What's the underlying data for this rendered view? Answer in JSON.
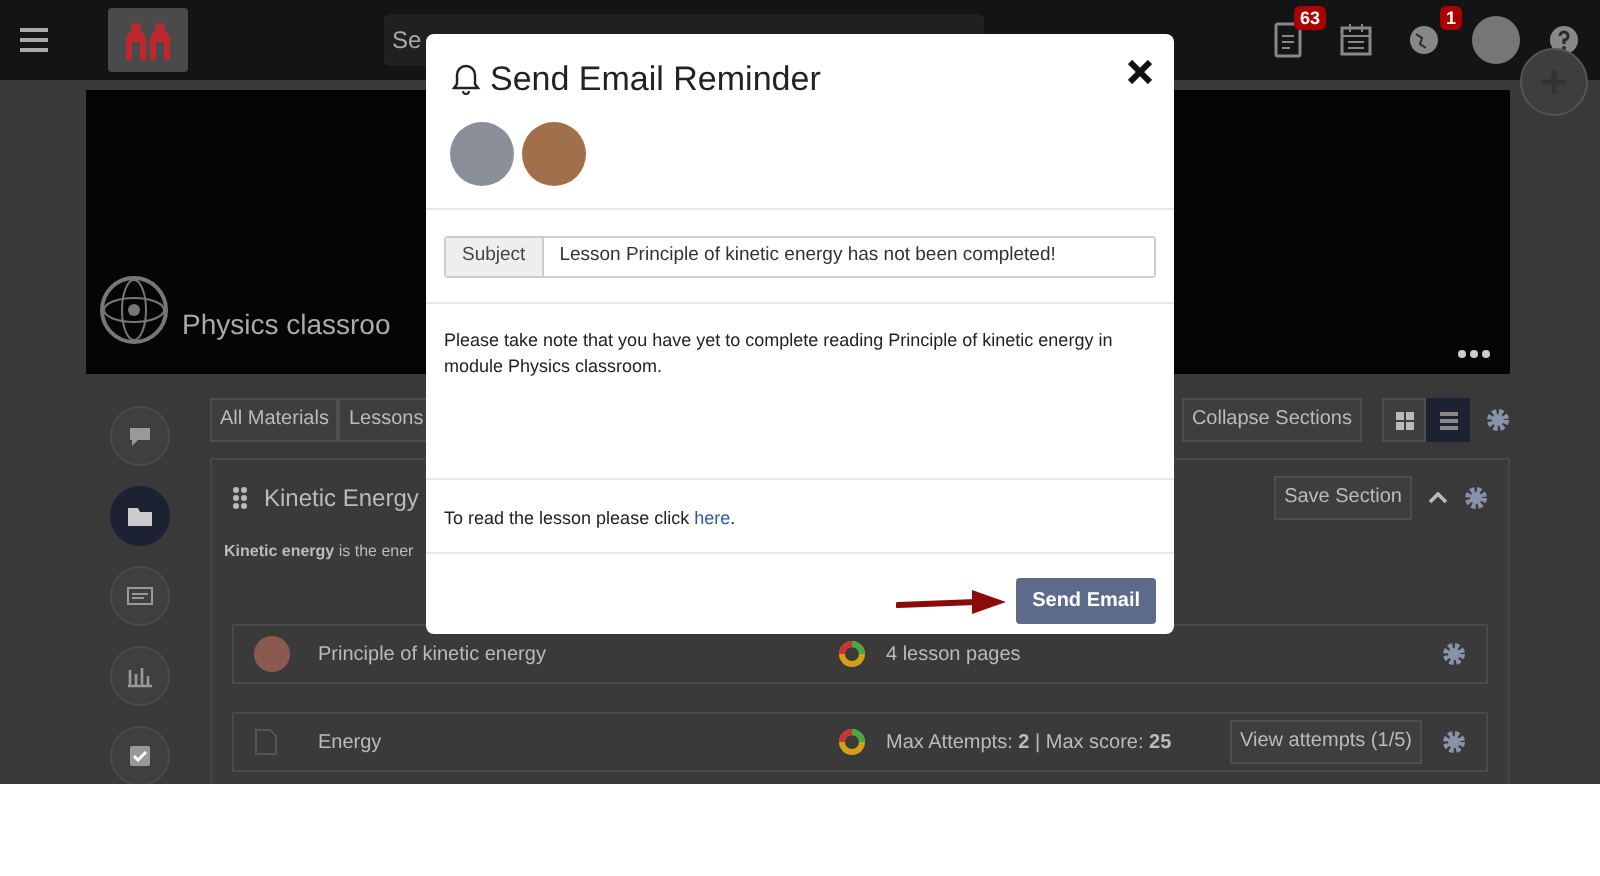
{
  "topbar": {
    "search_placeholder": "Se",
    "badges": [
      "63",
      "1"
    ]
  },
  "banner": {
    "title": "Physics classroo"
  },
  "sidebar": {
    "items": [
      {
        "kind": "chat",
        "selected": false
      },
      {
        "kind": "folder",
        "selected": true
      },
      {
        "kind": "card",
        "selected": false
      },
      {
        "kind": "chart",
        "selected": false
      },
      {
        "kind": "check",
        "selected": false
      }
    ]
  },
  "toolbar": {
    "filters": [
      "All Materials",
      "Lessons"
    ],
    "collapse_button": "Collapse Sections",
    "views": [
      {
        "kind": "grid",
        "selected": false
      },
      {
        "kind": "list",
        "selected": true
      }
    ]
  },
  "section": {
    "title": "Kinetic Energy",
    "save_button": "Save Section",
    "description": "**Kinetic energy** is the ener",
    "items": [
      {
        "kind": "lesson",
        "title": "Principle of kinetic energy",
        "info": "4 lesson pages"
      },
      {
        "kind": "quiz",
        "title": "Energy",
        "info": "Max Attempts: **2**  |  Max score: **25**",
        "action": "View attempts (1/5)"
      }
    ]
  },
  "modal": {
    "title": "Send Email Reminder",
    "recipients": [
      {
        "kind": "avatar"
      },
      {
        "kind": "avatar"
      }
    ],
    "subject_label": "Subject",
    "subject_value": "Lesson Principle of kinetic energy has not been completed!",
    "message": "Please take note that you have yet to complete reading Principle of kinetic energy in module Physics classroom.",
    "footer_text": {
      "before": "To read the lesson please click ",
      "link": "here",
      "after": "."
    },
    "send_button": "Send Email"
  }
}
